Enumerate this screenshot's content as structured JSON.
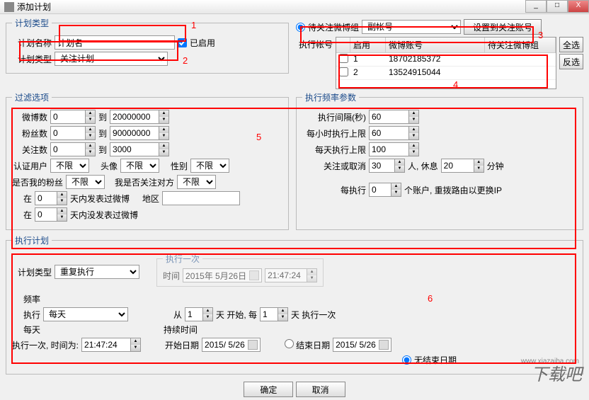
{
  "window": {
    "title": "添加计划",
    "min": "_",
    "max": "□",
    "close": "X"
  },
  "planType": {
    "legend": "计划类型",
    "nameLabel": "计划名称",
    "nameValue": "计划名",
    "enabledLabel": "已启用",
    "typeLabel": "计划类型",
    "typeValue": "关注计划"
  },
  "groupSection": {
    "radioLabel": "待关注微博组",
    "groupValue": "副帐号",
    "setBtn": "设置到关注账号",
    "execAcctLabel": "执行帐号",
    "headers": {
      "enable": "启用",
      "account": "微博账号",
      "target": "待关注微博组"
    },
    "rows": [
      {
        "idx": "1",
        "acct": "18702185372"
      },
      {
        "idx": "2",
        "acct": "13524915044"
      }
    ],
    "selectAll": "全选",
    "invert": "反选"
  },
  "filter": {
    "legend": "过滤选项",
    "weiboLabel": "微博数",
    "weiboFrom": "0",
    "to": "到",
    "weiboTo": "20000000",
    "fansLabel": "粉丝数",
    "fansFrom": "0",
    "fansTo": "90000000",
    "followLabel": "关注数",
    "followFrom": "0",
    "followTo": "3000",
    "verifyLabel": "认证用户",
    "verifyVal": "不限",
    "avatarLabel": "头像",
    "avatarVal": "不限",
    "genderLabel": "性别",
    "genderVal": "不限",
    "isMyFanLabel": "是否我的粉丝",
    "isMyFanVal": "不限",
    "amIFollowLabel": "我是否关注对方",
    "amIFollowVal": "不限",
    "inLabel1": "在",
    "inVal1": "0",
    "inSuffix1": "天内发表过微博",
    "regionLabel": "地区",
    "inLabel2": "在",
    "inVal2": "0",
    "inSuffix2": "天内没发表过微博"
  },
  "freq": {
    "legend": "执行频率参数",
    "intervalLabel": "执行间隔(秒)",
    "intervalVal": "60",
    "hourLimitLabel": "每小时执行上限",
    "hourLimitVal": "60",
    "dayLimitLabel": "每天执行上限",
    "dayLimitVal": "100",
    "actionLabel": "关注或取消",
    "actionVal": "30",
    "actionUnit": "人, 休息",
    "restVal": "20",
    "restUnit": "分钟",
    "perExecLabel": "每执行",
    "perExecVal": "0",
    "perExecSuffix": "个账户, 重拨路由以更换IP"
  },
  "exec": {
    "legend": "执行计划",
    "planTypeLabel": "计划类型",
    "planTypeVal": "重复执行",
    "onceLegend": "执行一次",
    "timeLabel": "时间",
    "dateVal": "2015年 5月26日",
    "timeVal": "21:47:24",
    "freqLabel": "频率",
    "execLabel": "执行",
    "execVal": "每天",
    "fromLabel": "从",
    "fromVal": "1",
    "fromSuffix": "天 开始, 每",
    "everyVal": "1",
    "everySuffix": "天 执行一次",
    "dailyLabel": "每天",
    "dailyTimeLabel": "执行一次, 时间为:",
    "dailyTimeVal": "21:47:24",
    "durationLabel": "持续时间",
    "startDateLabel": "开始日期",
    "startDateVal": "2015/ 5/26",
    "endDateLabel": "结束日期",
    "endDateVal": "2015/ 5/26",
    "noEndLabel": "无结束日期"
  },
  "buttons": {
    "ok": "确定",
    "cancel": "取消"
  },
  "watermark": {
    "url": "www.xiazaiba.com",
    "text": "下载吧"
  },
  "annot": {
    "n1": "1",
    "n2": "2",
    "n3": "3",
    "n4": "4",
    "n5": "5",
    "n6": "6"
  }
}
